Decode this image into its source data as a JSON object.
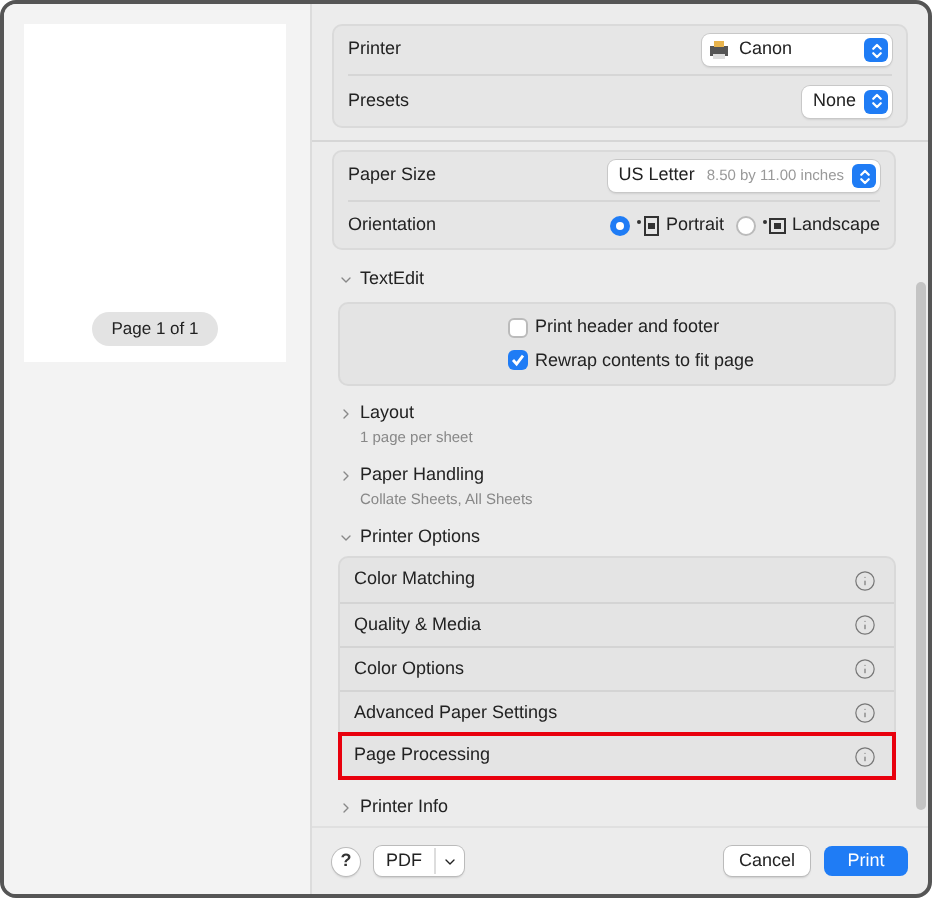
{
  "preview": {
    "page_label": "Page 1 of 1"
  },
  "printer": {
    "label": "Printer",
    "value": "Canon"
  },
  "presets": {
    "label": "Presets",
    "value": "None"
  },
  "page_setup": [
    {
      "kind": "select",
      "label": "Paper Size",
      "value": "US Letter",
      "detail": "8.50 by 11.00 inches"
    },
    {
      "kind": "radio",
      "label": "Orientation",
      "options": [
        {
          "label": "Portrait",
          "selected": true
        },
        {
          "label": "Landscape",
          "selected": false
        }
      ]
    }
  ],
  "sections": [
    {
      "title": "TextEdit",
      "expanded": true,
      "kind": "checkboxes",
      "items": [
        {
          "label": "Print header and footer",
          "checked": false
        },
        {
          "label": "Rewrap contents to fit page",
          "checked": true
        }
      ]
    },
    {
      "title": "Layout",
      "expanded": false,
      "summary": "1 page per sheet"
    },
    {
      "title": "Paper Handling",
      "expanded": false,
      "summary": "Collate Sheets, All Sheets"
    },
    {
      "title": "Printer Options",
      "expanded": true,
      "kind": "list",
      "items": [
        {
          "label": "Color Matching",
          "highlighted": false
        },
        {
          "label": "Quality & Media",
          "highlighted": false
        },
        {
          "label": "Color Options",
          "highlighted": false
        },
        {
          "label": "Advanced Paper Settings",
          "highlighted": false
        },
        {
          "label": "Page Processing",
          "highlighted": true
        }
      ]
    },
    {
      "title": "Printer Info",
      "expanded": false
    }
  ],
  "footer": {
    "help": "?",
    "pdf": "PDF",
    "cancel": "Cancel",
    "print": "Print"
  }
}
